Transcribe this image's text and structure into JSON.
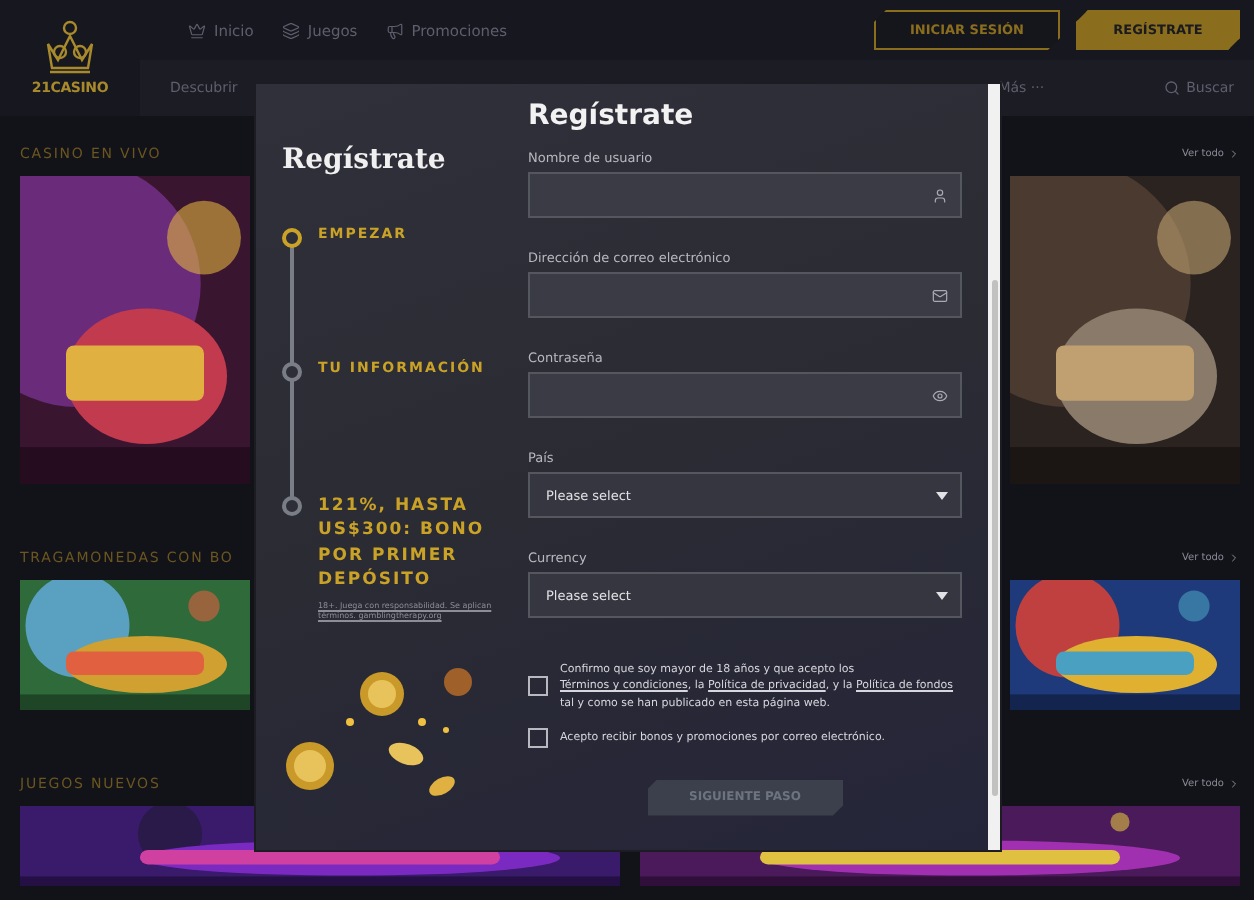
{
  "logo": {
    "text": "21CASINO"
  },
  "top_nav": [
    {
      "label": "Inicio"
    },
    {
      "label": "Juegos"
    },
    {
      "label": "Promociones"
    }
  ],
  "auth_buttons": [
    {
      "label": "INICIAR SESIÓN",
      "kind": "outline"
    },
    {
      "label": "REGÍSTRATE",
      "kind": "filled"
    }
  ],
  "nav": {
    "items": [
      "Descubrir"
    ],
    "more": "Más",
    "more_icon": "···",
    "search": "Buscar"
  },
  "sections": [
    {
      "title": "CASINO EN VIVO",
      "link": "Ver todo"
    },
    {
      "title": "TRAGAMONEDAS CON BO",
      "link": "Ver todo"
    },
    {
      "title": "JUEGOS NUEVOS",
      "link": "Ver todo"
    }
  ],
  "modal": {
    "title": "Regístrate",
    "steps_title": "Regístrate",
    "steps": [
      {
        "label": "EMPEZAR",
        "selected": true,
        "kind": "step"
      },
      {
        "label": "TU INFORMACIÓN",
        "selected": false,
        "kind": "step"
      },
      {
        "label": "121%, HASTA US$300: BONO POR PRIMER DEPÓSITO",
        "selected": false,
        "kind": "bonus",
        "note": "18+. Juega con responsabilidad. Se aplican términos. gamblingtherapy.org"
      }
    ],
    "fields": [
      {
        "kind": "input",
        "label": "Nombre de usuario"
      },
      {
        "kind": "input",
        "label": "Dirección de correo electrónico"
      },
      {
        "kind": "input",
        "label": "Contraseña"
      },
      {
        "kind": "select",
        "label": "País",
        "value": "Please select"
      },
      {
        "kind": "select",
        "label": "Currency",
        "value": "Please select"
      }
    ],
    "checkboxes": [
      {
        "checked": false,
        "parts": [
          {
            "kind": "text",
            "text": "Confirmo que soy mayor de 18 años y que acepto los "
          },
          {
            "kind": "link",
            "text": "Términos y condiciones"
          },
          {
            "kind": "text",
            "text": ", la "
          },
          {
            "kind": "link",
            "text": "Política de privacidad"
          },
          {
            "kind": "text",
            "text": ", y la "
          },
          {
            "kind": "link",
            "text": "Política de fondos"
          },
          {
            "kind": "text",
            "text": " tal y como se han publicado en esta página web."
          }
        ]
      },
      {
        "checked": false,
        "parts": [
          {
            "kind": "text",
            "text": "Acepto recibir bonos y promociones por correo electrónico."
          }
        ]
      }
    ],
    "submit": {
      "label": "SIGUIENTE PASO",
      "disabled": true
    }
  }
}
